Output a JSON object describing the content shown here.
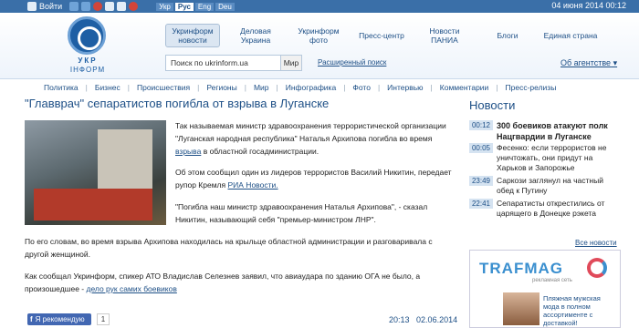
{
  "topbar": {
    "login": "Войти",
    "languages": [
      "Укр",
      "Рус",
      "Eng",
      "Deu"
    ],
    "active_language": "Рус",
    "datetime": "04 июня 2014 00:12"
  },
  "header": {
    "logo_line1": "УКР",
    "logo_line2": "ІНФОРМ",
    "nav_tabs": [
      {
        "label": "Укринформ новости"
      },
      {
        "label": "Деловая Украина"
      },
      {
        "label": "Укринформ фото"
      },
      {
        "label": "Пресс-центр"
      },
      {
        "label": "Новости ПАНИА"
      },
      {
        "label": "Блоги"
      },
      {
        "label": "Единая страна"
      }
    ],
    "search_placeholder": "Поиск по ukrinform.ua",
    "search_button": "Мир",
    "advanced_search": "Расширенный поиск",
    "about_agency": "Об агентстве"
  },
  "categories": [
    "Политика",
    "Бизнес",
    "Происшествия",
    "Регионы",
    "Мир",
    "Инфографика",
    "Фото",
    "Интервью",
    "Комментарии",
    "Пресс-релизы"
  ],
  "article": {
    "title": "\"Главврач\" сепаратистов погибла от взрыва в Луганске",
    "p1_text": "Так называемая министр здравоохранения террористической организации \"Луганская народная республика\" Наталья Архипова погибла во время",
    "p1_link": "взрыва",
    "p1_tail": "в областной госадминистрации.",
    "p2_text": "Об этом сообщил один из лидеров террористов Василий Никитин, передает рупор Кремля",
    "p2_link": "РИА Новости.",
    "p3_text": "\"Погибла наш министр здравоохранения Наталья Архипова\", - сказал Никитин, называющий себя \"премьер-министром ЛНР\".",
    "p4_text": "По его словам, во время взрыва Архипова находилась на крыльце областной администрации и разговаривала с другой женщиной.",
    "p5_text": "Как сообщал Укринформ, спикер АТО Владислав Селезнев заявил, что авиаудара по зданию ОГА не было, а произошедшее -",
    "p5_link": "дело рук самих боевиков",
    "like_label": "Я рекомендую",
    "like_count": "1",
    "time": "20:13",
    "date": "02.06.2014"
  },
  "sidebar": {
    "title": "Новости",
    "items": [
      {
        "time": "00:12",
        "text": "300 боевиков атакуют полк Нацгвардии в Луганске",
        "bold": true
      },
      {
        "time": "00:05",
        "text": "Фесенко: если террористов не уничтожать, они придут на Харьков и Запорожье",
        "bold": false
      },
      {
        "time": "23:49",
        "text": "Саркози заглянул на частный обед к Путину",
        "bold": false
      },
      {
        "time": "22:41",
        "text": "Сепаратисты открестились от царящего в Донецке рэкета",
        "bold": false
      }
    ],
    "all_news": "Все новости",
    "ad": {
      "logo": "TRAFMAG",
      "logo_sub": "рекламная сеть",
      "text": "Пляжная мужская мода в полном ассортименте с доставкой!"
    }
  }
}
